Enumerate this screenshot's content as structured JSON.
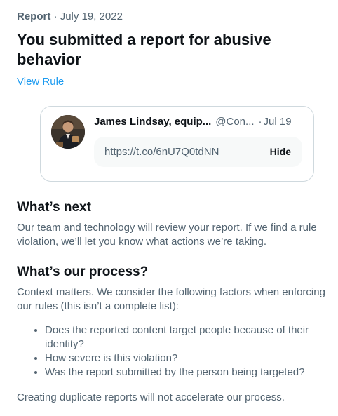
{
  "header": {
    "label": "Report",
    "separator": "·",
    "date": "July 19, 2022",
    "title": "You submitted a report for abusive behavior",
    "view_rule": "View Rule"
  },
  "tweet_card": {
    "author_name": "James Lindsay, equip...",
    "handle": "@Con...",
    "separator": "·",
    "date": "Jul 19",
    "link": "https://t.co/6nU7Q0tdNN",
    "hide_label": "Hide"
  },
  "whats_next": {
    "heading": "What’s next",
    "body": "Our team and technology will review your report. If we find a rule violation, we’ll let you know what actions we’re taking."
  },
  "process": {
    "heading": "What’s our process?",
    "intro": "Context matters. We consider the following factors when enforcing our rules (this isn’t a complete list):",
    "factors": [
      "Does the reported content target people because of their identity?",
      "How severe is this violation?",
      "Was the report submitted by the person being targeted?"
    ],
    "footer": "Creating duplicate reports will not accelerate our process."
  },
  "colors": {
    "accent": "#1d9bf0",
    "text_primary": "#0f1419",
    "text_secondary": "#536471",
    "border": "#cfd9de",
    "link_box_bg": "#f7f9f9"
  }
}
